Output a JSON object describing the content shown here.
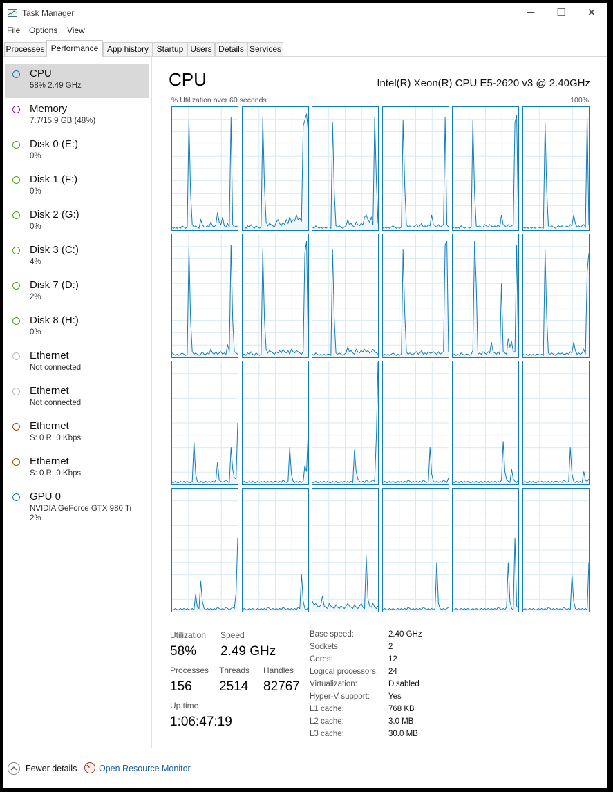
{
  "window": {
    "title": "Task Manager",
    "controls": {
      "minimize": "─",
      "maximize": "☐",
      "close": "✕"
    }
  },
  "menu": [
    "File",
    "Options",
    "View"
  ],
  "tabs": [
    "Processes",
    "Performance",
    "App history",
    "Startup",
    "Users",
    "Details",
    "Services"
  ],
  "active_tab": "Performance",
  "sidebar": {
    "items": [
      {
        "name": "CPU",
        "sub": "58%  2.49 GHz",
        "color": "#117dbb"
      },
      {
        "name": "Memory",
        "sub": "7.7/15.9 GB (48%)",
        "color": "#8b12ae"
      },
      {
        "name": "Disk 0 (E:)",
        "sub": "0%",
        "color": "#4da60c"
      },
      {
        "name": "Disk 1 (F:)",
        "sub": "0%",
        "color": "#4da60c"
      },
      {
        "name": "Disk 2 (G:)",
        "sub": "0%",
        "color": "#4da60c"
      },
      {
        "name": "Disk 3 (C:)",
        "sub": "4%",
        "color": "#4da60c"
      },
      {
        "name": "Disk 7 (D:)",
        "sub": "2%",
        "color": "#4da60c"
      },
      {
        "name": "Disk 8 (H:)",
        "sub": "0%",
        "color": "#4da60c"
      },
      {
        "name": "Ethernet",
        "sub": "Not connected",
        "color": "#bbbbbb"
      },
      {
        "name": "Ethernet",
        "sub": "Not connected",
        "color": "#bbbbbb"
      },
      {
        "name": "Ethernet",
        "sub": "S: 0  R: 0 Kbps",
        "color": "#a74f01"
      },
      {
        "name": "Ethernet",
        "sub": "S: 0  R: 0 Kbps",
        "color": "#a74f01"
      },
      {
        "name": "GPU 0",
        "sub": "NVIDIA GeForce GTX 980 Ti",
        "sub2": "2%",
        "color": "#117dbb"
      }
    ]
  },
  "main": {
    "title": "CPU",
    "cpu_model": "Intel(R) Xeon(R) CPU E5-2620 v3 @ 2.40GHz",
    "graph_label": "% Utilization over 60 seconds",
    "graph_max": "100%"
  },
  "stats": {
    "utilization_label": "Utilization",
    "utilization": "58%",
    "speed_label": "Speed",
    "speed": "2.49 GHz",
    "processes_label": "Processes",
    "processes": "156",
    "threads_label": "Threads",
    "threads": "2514",
    "handles_label": "Handles",
    "handles": "82767",
    "uptime_label": "Up time",
    "uptime": "1:06:47:19"
  },
  "specs": [
    {
      "label": "Base speed:",
      "value": "2.40 GHz"
    },
    {
      "label": "Sockets:",
      "value": "2"
    },
    {
      "label": "Cores:",
      "value": "12"
    },
    {
      "label": "Logical processors:",
      "value": "24"
    },
    {
      "label": "Virtualization:",
      "value": "Disabled"
    },
    {
      "label": "Hyper-V support:",
      "value": "Yes"
    },
    {
      "label": "L1 cache:",
      "value": "768 KB"
    },
    {
      "label": "L2 cache:",
      "value": "3.0 MB"
    },
    {
      "label": "L3 cache:",
      "value": "30.0 MB"
    }
  ],
  "footer": {
    "fewer_details": "Fewer details",
    "open_resource_monitor": "Open Resource Monitor"
  },
  "colors": {
    "graph_line": "#117dbb",
    "graph_grid": "#d9eaf4",
    "selected_bg": "#d9d9d9",
    "link": "#1a5ea8"
  },
  "chart_data": {
    "type": "line",
    "title": "% Utilization over 60 seconds",
    "ylim": [
      0,
      100
    ],
    "grid": true,
    "cores": [
      [
        2,
        1,
        2,
        1,
        2,
        1,
        3,
        2,
        1,
        2,
        90,
        30,
        4,
        2,
        3,
        2,
        1,
        8,
        4,
        2,
        2,
        3,
        2,
        6,
        3,
        2,
        4,
        14,
        6,
        4,
        10,
        3,
        2,
        5,
        2,
        92,
        4,
        2,
        3,
        2
      ],
      [
        2,
        2,
        1,
        3,
        2,
        4,
        2,
        1,
        3,
        2,
        1,
        2,
        92,
        35,
        6,
        3,
        5,
        4,
        3,
        2,
        6,
        8,
        5,
        3,
        6,
        4,
        8,
        5,
        10,
        6,
        8,
        7,
        12,
        8,
        9,
        7,
        85,
        90,
        95,
        80
      ],
      [
        2,
        1,
        3,
        2,
        1,
        2,
        1,
        2,
        1,
        2,
        2,
        1,
        88,
        30,
        3,
        2,
        3,
        2,
        1,
        2,
        3,
        8,
        4,
        5,
        3,
        2,
        6,
        4,
        3,
        5,
        4,
        10,
        12,
        8,
        6,
        10,
        4,
        92,
        40,
        5
      ],
      [
        1,
        2,
        1,
        2,
        1,
        2,
        3,
        2,
        1,
        2,
        1,
        2,
        90,
        35,
        4,
        2,
        3,
        2,
        2,
        3,
        4,
        2,
        3,
        5,
        2,
        3,
        2,
        4,
        3,
        12,
        4,
        3,
        2,
        4,
        2,
        3,
        4,
        92,
        4,
        2
      ],
      [
        1,
        2,
        1,
        2,
        1,
        3,
        2,
        1,
        2,
        2,
        1,
        2,
        90,
        30,
        3,
        2,
        3,
        2,
        2,
        4,
        3,
        2,
        4,
        3,
        2,
        3,
        2,
        4,
        2,
        12,
        4,
        3,
        2,
        4,
        2,
        3,
        4,
        88,
        94,
        5
      ],
      [
        2,
        1,
        2,
        1,
        2,
        1,
        2,
        1,
        2,
        2,
        1,
        2,
        1,
        88,
        32,
        3,
        2,
        3,
        2,
        1,
        2,
        3,
        2,
        3,
        2,
        2,
        3,
        2,
        4,
        3,
        12,
        5,
        2,
        3,
        2,
        3,
        4,
        2,
        92,
        4
      ],
      [
        3,
        2,
        1,
        2,
        1,
        2,
        3,
        2,
        1,
        2,
        90,
        30,
        4,
        2,
        3,
        2,
        1,
        2,
        4,
        2,
        2,
        3,
        2,
        6,
        3,
        2,
        4,
        2,
        3,
        4,
        2,
        3,
        2,
        10,
        4,
        92,
        30,
        4,
        3,
        2
      ],
      [
        2,
        2,
        1,
        3,
        2,
        4,
        2,
        1,
        3,
        2,
        1,
        2,
        88,
        30,
        6,
        3,
        5,
        4,
        3,
        2,
        4,
        3,
        5,
        3,
        6,
        4,
        3,
        5,
        2,
        6,
        4,
        3,
        5,
        4,
        3,
        2,
        4,
        85,
        95,
        4
      ],
      [
        2,
        1,
        3,
        2,
        1,
        2,
        1,
        2,
        1,
        2,
        2,
        1,
        88,
        30,
        3,
        2,
        3,
        2,
        1,
        2,
        3,
        8,
        4,
        5,
        3,
        2,
        6,
        4,
        3,
        5,
        4,
        6,
        4,
        5,
        3,
        4,
        6,
        4,
        3,
        2
      ],
      [
        1,
        2,
        1,
        2,
        1,
        2,
        3,
        2,
        1,
        2,
        1,
        2,
        88,
        35,
        4,
        2,
        3,
        2,
        2,
        3,
        4,
        2,
        3,
        5,
        2,
        3,
        2,
        4,
        3,
        3,
        4,
        3,
        2,
        4,
        2,
        3,
        4,
        92,
        95,
        4
      ],
      [
        1,
        2,
        1,
        2,
        1,
        3,
        2,
        1,
        2,
        2,
        1,
        2,
        5,
        95,
        60,
        2,
        3,
        2,
        4,
        3,
        2,
        4,
        3,
        12,
        4,
        3,
        2,
        4,
        2,
        60,
        4,
        3,
        2,
        15,
        8,
        12,
        4,
        4,
        92,
        5
      ],
      [
        2,
        1,
        2,
        1,
        2,
        1,
        2,
        1,
        2,
        2,
        1,
        2,
        1,
        88,
        32,
        3,
        2,
        3,
        2,
        1,
        2,
        3,
        2,
        3,
        2,
        2,
        3,
        2,
        4,
        3,
        12,
        5,
        2,
        3,
        2,
        3,
        6,
        2,
        70,
        85
      ],
      [
        1,
        1,
        2,
        1,
        1,
        2,
        1,
        2,
        1,
        2,
        1,
        1,
        2,
        35,
        8,
        2,
        1,
        2,
        1,
        1,
        2,
        1,
        2,
        1,
        2,
        1,
        3,
        18,
        3,
        2,
        1,
        2,
        3,
        2,
        1,
        30,
        12,
        5,
        4,
        50
      ],
      [
        1,
        2,
        1,
        1,
        2,
        1,
        2,
        1,
        1,
        2,
        1,
        2,
        1,
        2,
        1,
        2,
        1,
        2,
        1,
        2,
        2,
        1,
        2,
        1,
        3,
        2,
        1,
        2,
        30,
        8,
        2,
        1,
        2,
        1,
        2,
        1,
        2,
        15,
        10,
        45
      ],
      [
        1,
        1,
        2,
        1,
        1,
        2,
        1,
        2,
        1,
        2,
        1,
        1,
        2,
        1,
        2,
        1,
        1,
        2,
        1,
        2,
        1,
        2,
        1,
        2,
        1,
        28,
        10,
        4,
        2,
        1,
        2,
        1,
        3,
        2,
        1,
        2,
        3,
        2,
        40,
        100
      ],
      [
        1,
        2,
        1,
        1,
        2,
        1,
        2,
        1,
        1,
        2,
        1,
        2,
        1,
        2,
        1,
        3,
        2,
        1,
        2,
        1,
        2,
        1,
        2,
        1,
        3,
        2,
        1,
        2,
        30,
        8,
        2,
        1,
        2,
        1,
        2,
        1,
        3,
        2,
        1,
        5
      ],
      [
        1,
        1,
        2,
        1,
        1,
        2,
        1,
        2,
        1,
        2,
        1,
        1,
        2,
        1,
        2,
        1,
        1,
        2,
        1,
        2,
        1,
        2,
        1,
        2,
        1,
        2,
        1,
        2,
        1,
        3,
        35,
        10,
        4,
        2,
        1,
        12,
        4,
        2,
        1,
        3
      ],
      [
        1,
        2,
        1,
        1,
        2,
        1,
        2,
        1,
        1,
        2,
        1,
        2,
        1,
        2,
        1,
        2,
        1,
        2,
        1,
        2,
        2,
        1,
        2,
        1,
        3,
        2,
        1,
        2,
        30,
        8,
        2,
        1,
        2,
        1,
        2,
        1,
        10,
        3,
        2,
        4
      ],
      [
        1,
        1,
        2,
        1,
        1,
        2,
        1,
        2,
        1,
        2,
        1,
        1,
        2,
        1,
        14,
        3,
        2,
        25,
        8,
        2,
        1,
        2,
        1,
        2,
        1,
        2,
        1,
        3,
        2,
        1,
        2,
        1,
        3,
        2,
        1,
        2,
        3,
        2,
        15,
        60
      ],
      [
        1,
        2,
        1,
        1,
        2,
        1,
        2,
        1,
        1,
        2,
        1,
        2,
        1,
        2,
        1,
        3,
        2,
        1,
        2,
        1,
        2,
        1,
        2,
        1,
        3,
        2,
        1,
        2,
        1,
        2,
        1,
        2,
        1,
        3,
        2,
        30,
        8,
        2,
        1,
        3
      ],
      [
        8,
        5,
        6,
        4,
        3,
        5,
        12,
        4,
        3,
        2,
        6,
        4,
        3,
        2,
        5,
        3,
        2,
        4,
        3,
        2,
        4,
        6,
        4,
        3,
        2,
        5,
        3,
        2,
        4,
        6,
        3,
        2,
        45,
        10,
        4,
        3,
        6,
        3,
        2,
        4
      ],
      [
        1,
        2,
        1,
        1,
        2,
        1,
        2,
        1,
        1,
        2,
        1,
        2,
        1,
        2,
        1,
        3,
        2,
        1,
        2,
        1,
        2,
        1,
        2,
        1,
        3,
        2,
        1,
        2,
        1,
        2,
        1,
        2,
        40,
        6,
        2,
        1,
        2,
        1,
        2,
        3
      ],
      [
        1,
        1,
        2,
        1,
        1,
        2,
        1,
        2,
        1,
        2,
        1,
        1,
        2,
        1,
        2,
        1,
        1,
        2,
        1,
        2,
        1,
        2,
        1,
        2,
        1,
        2,
        1,
        3,
        2,
        1,
        2,
        1,
        3,
        40,
        8,
        2,
        1,
        60,
        4,
        2
      ],
      [
        1,
        2,
        1,
        1,
        2,
        1,
        2,
        1,
        1,
        2,
        1,
        2,
        1,
        2,
        1,
        3,
        2,
        1,
        2,
        1,
        2,
        1,
        2,
        1,
        3,
        2,
        1,
        2,
        1,
        30,
        8,
        2,
        1,
        2,
        1,
        2,
        1,
        2,
        1,
        40
      ]
    ]
  }
}
